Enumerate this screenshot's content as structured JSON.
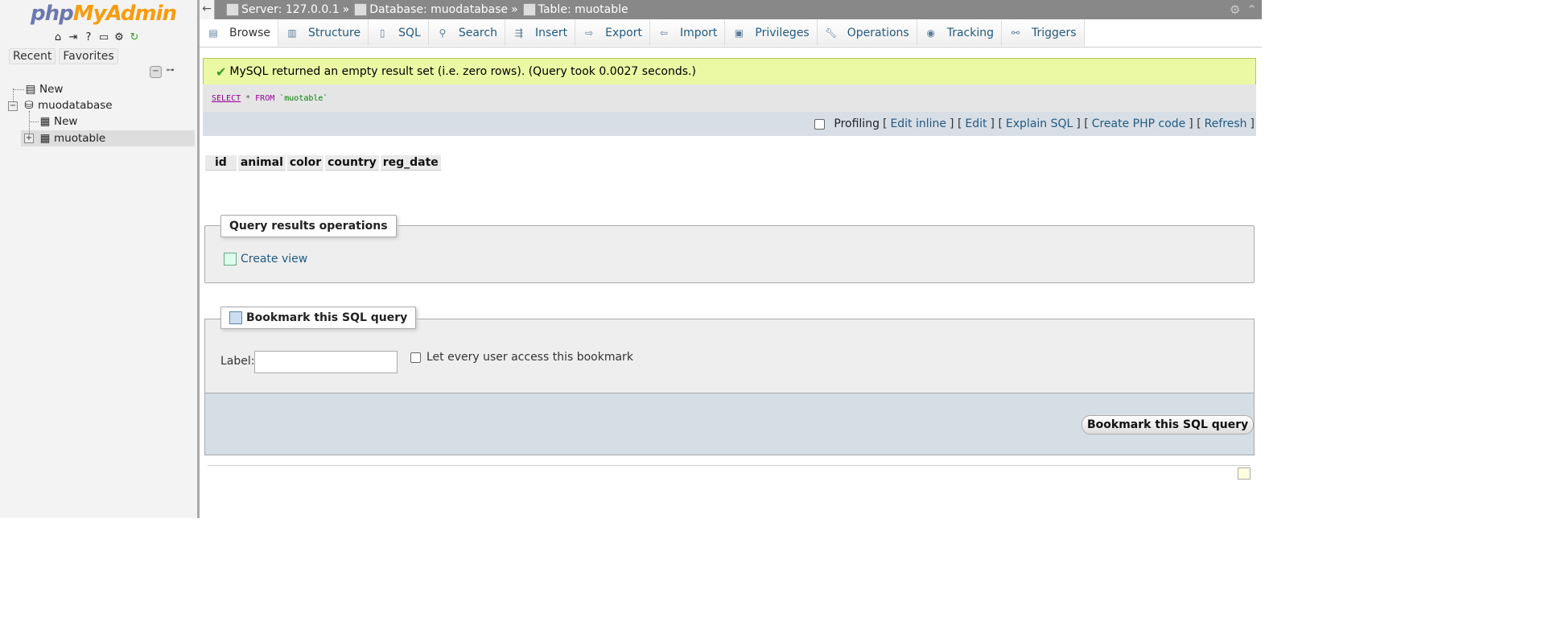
{
  "sidebar": {
    "logo": {
      "php": "php",
      "my": "My",
      "admin": "Admin"
    },
    "quick_icons": [
      "home-icon",
      "exit-icon",
      "help-icon",
      "docs-icon",
      "settings-icon",
      "reload-icon"
    ],
    "tabs": {
      "recent": "Recent",
      "favorites": "Favorites"
    },
    "tree": {
      "new_server": "New",
      "database": "muodatabase",
      "new_table": "New",
      "table": "muotable"
    }
  },
  "topbar": {
    "server": "Server: 127.0.0.1",
    "sep": "»",
    "database": "Database: muodatabase",
    "table": "Table: muotable"
  },
  "tabs": [
    {
      "label": "Browse",
      "icon": "browse-icon"
    },
    {
      "label": "Structure",
      "icon": "structure-icon"
    },
    {
      "label": "SQL",
      "icon": "sql-icon"
    },
    {
      "label": "Search",
      "icon": "search-icon"
    },
    {
      "label": "Insert",
      "icon": "insert-icon"
    },
    {
      "label": "Export",
      "icon": "export-icon"
    },
    {
      "label": "Import",
      "icon": "import-icon"
    },
    {
      "label": "Privileges",
      "icon": "privileges-icon"
    },
    {
      "label": "Operations",
      "icon": "operations-icon"
    },
    {
      "label": "Tracking",
      "icon": "tracking-icon"
    },
    {
      "label": "Triggers",
      "icon": "triggers-icon"
    }
  ],
  "message": "MySQL returned an empty result set (i.e. zero rows). (Query took 0.0027 seconds.)",
  "sql": {
    "select": "SELECT",
    "star": "*",
    "from": "FROM",
    "table": "`muotable`"
  },
  "sql_links": {
    "profiling": "Profiling",
    "edit_inline": "Edit inline",
    "edit": "Edit",
    "explain": "Explain SQL",
    "create_php": "Create PHP code",
    "refresh": "Refresh"
  },
  "columns": [
    "id",
    "animal",
    "color",
    "country",
    "reg_date"
  ],
  "query_ops": {
    "legend": "Query results operations",
    "create_view": "Create view"
  },
  "bookmark": {
    "legend": "Bookmark this SQL query",
    "label": "Label:",
    "label_value": "",
    "share": "Let every user access this bookmark",
    "button": "Bookmark this SQL query"
  },
  "colors": {
    "link": "#235a81",
    "success_bg": "#ebf8a4",
    "topbar": "#888888"
  }
}
